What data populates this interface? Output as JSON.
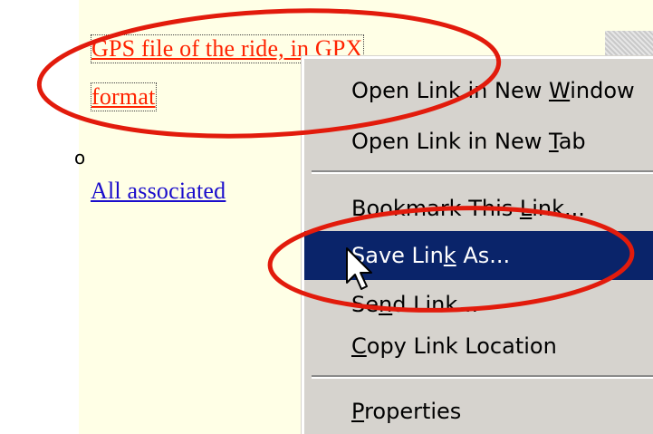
{
  "page": {
    "left_fragment": "o",
    "gps_link_line1": "GPS file of the ride, in GPX",
    "gps_link_line2": "format",
    "all_associated_link": "All associated"
  },
  "context_menu": {
    "items": [
      {
        "pre": "Open Link in New ",
        "key": "W",
        "post": "indow"
      },
      {
        "pre": "Open Link in New ",
        "key": "T",
        "post": "ab"
      },
      {
        "pre": "Bookmark This ",
        "key": "L",
        "post": "ink..."
      },
      {
        "pre": "Save Lin",
        "key": "k",
        "post": " As..."
      },
      {
        "pre": "Se",
        "key": "n",
        "post": "d Link..."
      },
      {
        "pre": "",
        "key": "C",
        "post": "opy Link Location"
      },
      {
        "pre": "",
        "key": "P",
        "post": "roperties"
      }
    ],
    "highlighted_index": 3
  },
  "annotations": {
    "color": "#e21b0c",
    "circled": [
      "gps-link",
      "save-link-as"
    ]
  },
  "colors": {
    "page_background": "#ffffe6",
    "menu_background": "#d6d3ce",
    "menu_highlight": "#0a246a",
    "visited_link": "#ff2200",
    "link": "#1a0dcc"
  }
}
